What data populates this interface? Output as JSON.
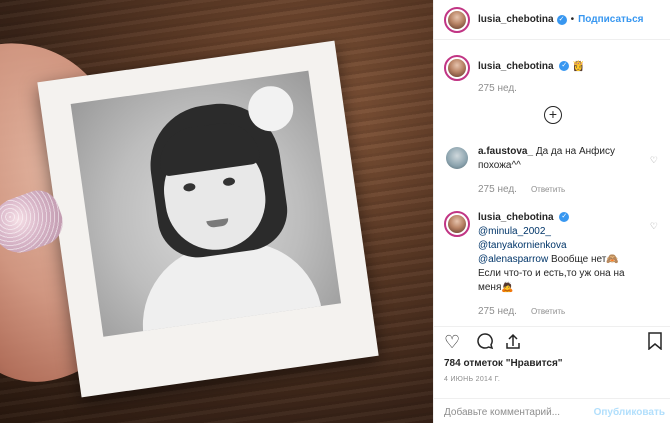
{
  "header": {
    "username": "lusia_chebotina",
    "separator": "•",
    "follow_label": "Подписаться"
  },
  "caption": {
    "username": "lusia_chebotina",
    "text": "👸",
    "time": "275 нед."
  },
  "load_more_icon": "plus-circle-icon",
  "comments": [
    {
      "username": "a.faustova_",
      "text": "Да да на Анфису похожа^^",
      "time": "275 нед.",
      "reply_label": "Ответить"
    },
    {
      "username": "lusia_chebotina",
      "mentions": [
        "@minula_2002_",
        "@tanyakornienkova",
        "@alenasparrow"
      ],
      "text_line1": "Вообще нет🙈",
      "text_rest": "Если что-то и есть,то уж она на меня🙇",
      "time": "275 нед.",
      "reply_label": "Ответить"
    }
  ],
  "actions": {
    "icons": [
      "heart-icon",
      "comment-icon",
      "share-icon",
      "bookmark-icon"
    ]
  },
  "likes_text": "784 отметок \"Нравится\"",
  "date_text": "4 ИЮНЬ 2014 Г.",
  "comment_box": {
    "placeholder": "Добавьте комментарий...",
    "publish_label": "Опубликовать"
  },
  "colors": {
    "accent": "#3897f0",
    "muted": "#8e8e8e",
    "text": "#262626",
    "publish_disabled": "#b2dffc"
  }
}
